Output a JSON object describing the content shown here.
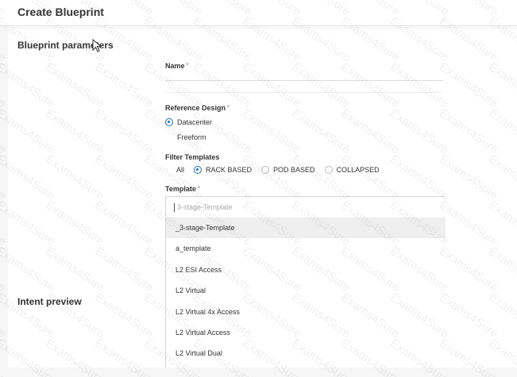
{
  "page": {
    "title": "Create Blueprint"
  },
  "parameters": {
    "section_title": "Blueprint parameters",
    "name_label": "Name",
    "required_mark": "*",
    "name_value": "",
    "reference_design_label": "Reference Design",
    "reference_designs": [
      {
        "label": "Datacenter",
        "selected": true
      },
      {
        "label": "Freeform",
        "selected": false
      }
    ],
    "filter_label": "Filter Templates",
    "filters": [
      {
        "label": "All",
        "selected": false
      },
      {
        "label": "RACK BASED",
        "selected": true
      },
      {
        "label": "POD BASED",
        "selected": false
      },
      {
        "label": "COLLAPSED",
        "selected": false
      }
    ],
    "template_label": "Template",
    "template_search_placeholder": "3-stage-Template",
    "template_options": [
      {
        "label": "_3-stage-Template",
        "highlighted": true
      },
      {
        "label": "a_template",
        "highlighted": false
      },
      {
        "label": "L2 ESI Access",
        "highlighted": false
      },
      {
        "label": "L2 Virtual",
        "highlighted": false
      },
      {
        "label": "L2 Virtual 4x Access",
        "highlighted": false
      },
      {
        "label": "L2 Virtual Access",
        "highlighted": false
      },
      {
        "label": "L2 Virtual Dual",
        "highlighted": false
      }
    ]
  },
  "intent": {
    "section_title": "Intent preview"
  },
  "watermark_text": "Exams4Sure",
  "colors": {
    "accent": "#1f6fb2",
    "highlight": "#efefef"
  }
}
